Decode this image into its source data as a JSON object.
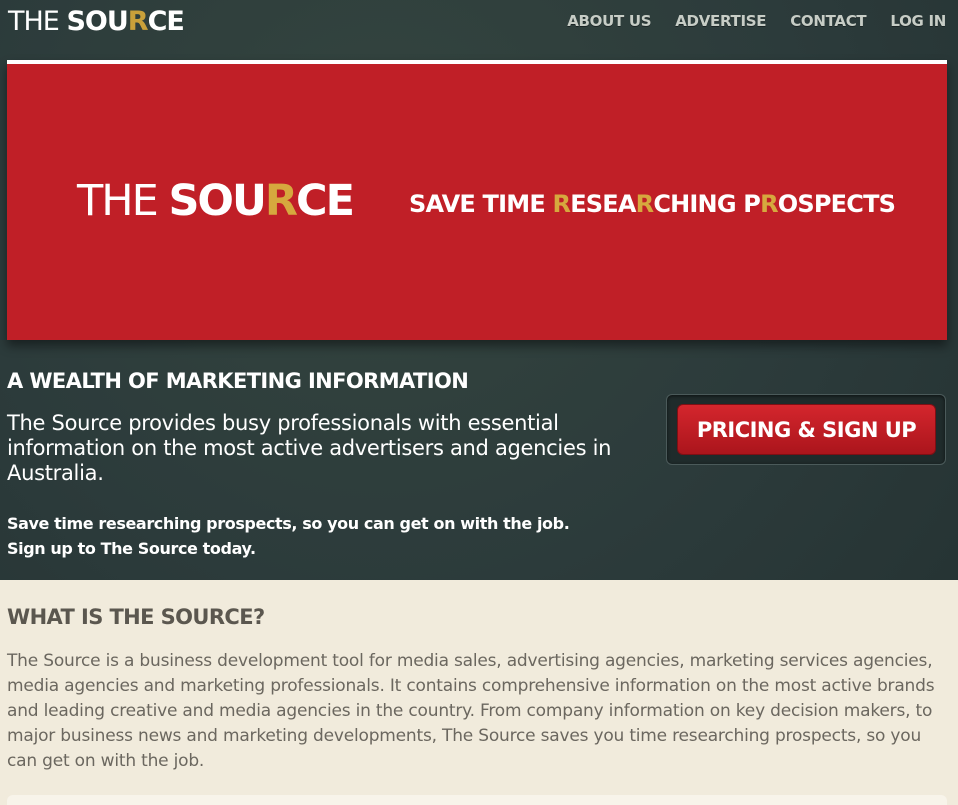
{
  "header": {
    "logo": {
      "pre": "THE ",
      "bold_a": "SOU",
      "r": "R",
      "bold_b": "CE"
    },
    "nav": [
      {
        "label": "ABOUT US"
      },
      {
        "label": "ADVERTISE"
      },
      {
        "label": "CONTACT"
      },
      {
        "label": "LOG IN"
      }
    ]
  },
  "hero": {
    "logo": {
      "pre": "THE ",
      "bold_a": "SOU",
      "r": "R",
      "bold_b": "CE"
    },
    "tagline": {
      "p1": "SAVE TIME ",
      "g1": "R",
      "p2": "ESEA",
      "g2": "R",
      "p3": "CHING P",
      "g3": "R",
      "p4": "OSPECTS"
    }
  },
  "intro": {
    "heading": "A WEALTH OF MARKETING INFORMATION",
    "text": "The Source provides busy professionals with essential information on the most active advertisers and agencies in Australia.",
    "cta_line1": "Save time researching prospects, so you can get on with the job.",
    "cta_line2": "Sign up to The Source today.",
    "button": "PRICING & SIGN UP"
  },
  "what": {
    "heading": "WHAT IS THE SOURCE?",
    "text": "The Source is a business development tool for media sales, advertising agencies, marketing services agencies, media agencies and marketing professionals. It contains comprehensive information on the most active brands and leading creative and media agencies in the country. From company information on key decision makers, to major business news and marketing developments, The Source saves you time researching prospects, so you can get on with the job."
  },
  "colors": {
    "top_bg": "#2c3b3b",
    "hero_red": "#c01f27",
    "gold": "#d6a83e",
    "bottom_bg": "#f1ebdc"
  }
}
